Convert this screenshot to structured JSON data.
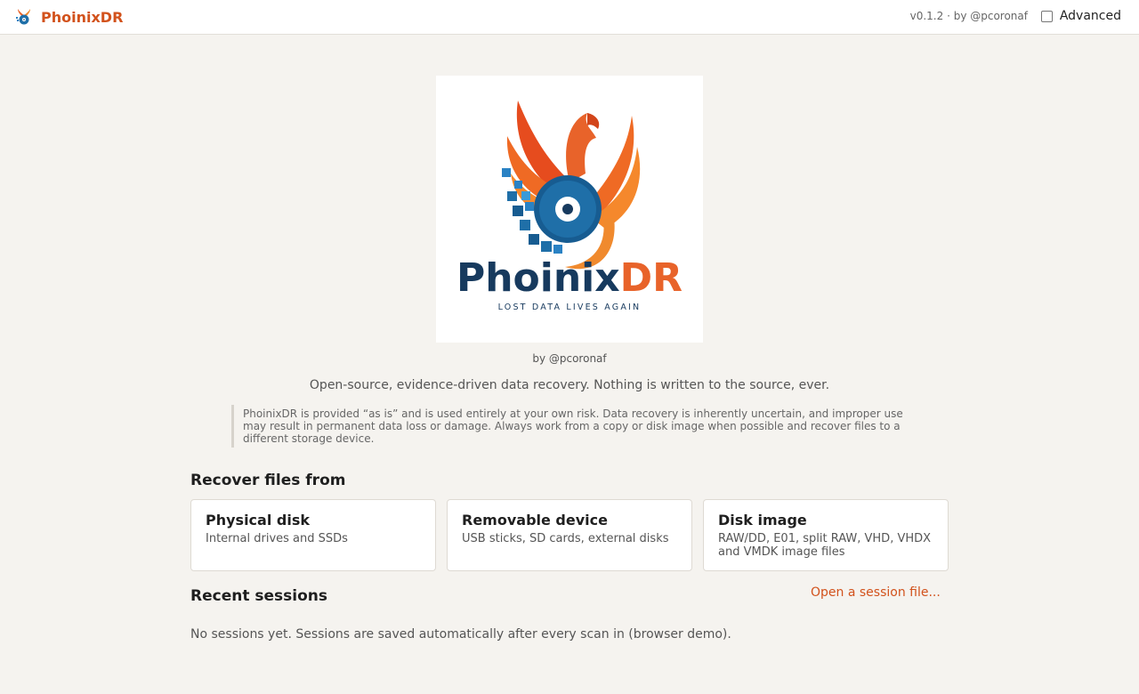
{
  "app": {
    "name": "PhoinixDR",
    "icon": "phoenix-disc-icon"
  },
  "header": {
    "version": "v0.1.2 · by @pcoronaf",
    "advanced_label": "Advanced",
    "advanced_checked": false
  },
  "logo": {
    "wordmark_dark": "Phoinix",
    "wordmark_accent": "DR",
    "slogan": "LOST DATA LIVES AGAIN"
  },
  "byline": "by @pcoronaf",
  "tagline": "Open-source, evidence-driven data recovery. Nothing is written to the source, ever.",
  "disclaimer": "PhoinixDR is provided “as is” and is used entirely at your own risk. Data recovery is inherently uncertain, and improper use may result in permanent data loss or damage. Always work from a copy or disk image when possible and recover files to a different storage device.",
  "recover": {
    "title": "Recover files from",
    "cards": [
      {
        "title": "Physical disk",
        "desc": "Internal drives and SSDs"
      },
      {
        "title": "Removable device",
        "desc": "USB sticks, SD cards, external disks"
      },
      {
        "title": "Disk image",
        "desc": "RAW/DD, E01, split RAW, VHD, VHDX and VMDK image files"
      }
    ]
  },
  "recent": {
    "title": "Recent sessions",
    "open_label": "Open a session file...",
    "empty_text": "No sessions yet. Sessions are saved automatically after every scan in (browser demo)."
  },
  "colors": {
    "accent": "#d2521c",
    "navy": "#173a5e",
    "background": "#f5f3ef"
  }
}
